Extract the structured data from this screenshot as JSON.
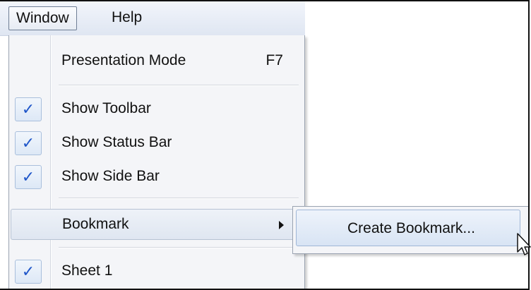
{
  "menubar": {
    "items": [
      {
        "label": "Window"
      },
      {
        "label": "Help"
      }
    ]
  },
  "window_menu": {
    "items": [
      {
        "label": "Presentation Mode",
        "shortcut": "F7",
        "checked": false
      },
      {
        "label": "Show Toolbar",
        "checked": true
      },
      {
        "label": "Show Status Bar",
        "checked": true
      },
      {
        "label": "Show Side Bar",
        "checked": true
      },
      {
        "label": "Bookmark",
        "has_submenu": true
      },
      {
        "label": "Sheet 1",
        "checked": true
      }
    ],
    "check_glyph": "✓"
  },
  "bookmark_submenu": {
    "items": [
      {
        "label": "Create Bookmark..."
      }
    ]
  },
  "colors": {
    "check": "#1f56c9",
    "highlight_border": "#9fb6d6",
    "menu_background": "#f4f5f8"
  },
  "icons": {
    "cursor": "arrow-pointer-icon",
    "submenu_arrow": "chevron-right-icon",
    "check": "checkmark-icon"
  }
}
